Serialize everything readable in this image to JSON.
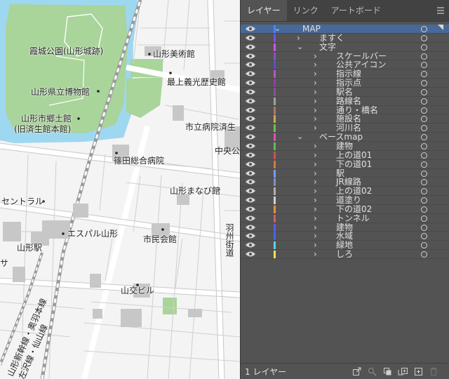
{
  "map": {
    "labels": {
      "park": "霞城公園(山形城跡)",
      "art_museum": "山形美術館",
      "prefectural_museum": "山形県立博物館",
      "mogami": "最上義光歴史館",
      "local_museum_1": "山形市郷土館",
      "local_museum_2": "(旧済生館本館)",
      "city_hospital": "市立病院済生",
      "central": "中央公",
      "shinoda": "篠田総合病院",
      "manabi": "山形まなび館",
      "central_left": "セントラル",
      "s_pal": "エスパル山形",
      "yamagata_station": "山形駅",
      "civic_hall": "市民会館",
      "sankou": "山交ビル",
      "avenue": "羽州街道",
      "line_1": "山形新幹線・奥羽本線",
      "line_2": "左沢線・仙山線",
      "sa": "サ"
    }
  },
  "panel": {
    "tabs": [
      "レイヤー",
      "リンク",
      "アートボード"
    ],
    "menu_icon": "panel-menu-icon",
    "layers": [
      {
        "name": "MAP",
        "level": 0,
        "expanded": true,
        "color": "#4f7fff",
        "selected": true
      },
      {
        "name": "ますく",
        "level": 1,
        "expanded": false,
        "color": "#7c4fff"
      },
      {
        "name": "文字",
        "level": 1,
        "expanded": true,
        "color": "#d04fff"
      },
      {
        "name": "スケールバー",
        "level": 2,
        "expanded": false,
        "color": "#8a4fc9"
      },
      {
        "name": "公共アイコン",
        "level": 2,
        "expanded": false,
        "color": "#5a4fcf"
      },
      {
        "name": "指示線",
        "level": 2,
        "expanded": false,
        "color": "#c04fc9"
      },
      {
        "name": "指示点",
        "level": 2,
        "expanded": false,
        "color": "#9a3aa6"
      },
      {
        "name": "駅名",
        "level": 2,
        "expanded": false,
        "color": "#7b5a8a"
      },
      {
        "name": "路線名",
        "level": 2,
        "expanded": false,
        "color": "#a0a0a0"
      },
      {
        "name": "通り・橋名",
        "level": 2,
        "expanded": false,
        "color": "#b07a5a"
      },
      {
        "name": "施設名",
        "level": 2,
        "expanded": false,
        "color": "#d4a85a"
      },
      {
        "name": "河川名",
        "level": 2,
        "expanded": false,
        "color": "#6cc04f"
      },
      {
        "name": "ベースmap",
        "level": 1,
        "expanded": true,
        "color": "#e04fb0"
      },
      {
        "name": "建物",
        "level": 2,
        "expanded": false,
        "color": "#5ac04f"
      },
      {
        "name": "上の道01",
        "level": 2,
        "expanded": false,
        "color": "#d05050"
      },
      {
        "name": "下の道01",
        "level": 2,
        "expanded": false,
        "color": "#d87a3a"
      },
      {
        "name": "駅",
        "level": 2,
        "expanded": false,
        "color": "#7a9aff"
      },
      {
        "name": "JR線路",
        "level": 2,
        "expanded": false,
        "color": "#8a8acb"
      },
      {
        "name": "上の道02",
        "level": 2,
        "expanded": false,
        "color": "#b0b0b0"
      },
      {
        "name": "道塗り",
        "level": 2,
        "expanded": false,
        "color": "#d0d0d0"
      },
      {
        "name": "下の道02",
        "level": 2,
        "expanded": false,
        "color": "#ff8a3a"
      },
      {
        "name": "トンネル",
        "level": 2,
        "expanded": false,
        "color": "#d06060"
      },
      {
        "name": "建物",
        "level": 2,
        "expanded": false,
        "color": "#5a5aff"
      },
      {
        "name": "水域",
        "level": 2,
        "expanded": false,
        "color": "#3a6aff"
      },
      {
        "name": "緑地",
        "level": 2,
        "expanded": false,
        "color": "#5ad0ff"
      },
      {
        "name": "しろ",
        "level": 2,
        "expanded": false,
        "color": "#ffe04f"
      }
    ],
    "footer": {
      "layer_count": "1 レイヤー",
      "icons": [
        "export-icon",
        "search-icon",
        "clipping-mask-icon",
        "new-sublayer-icon",
        "new-layer-icon",
        "delete-icon"
      ]
    }
  }
}
